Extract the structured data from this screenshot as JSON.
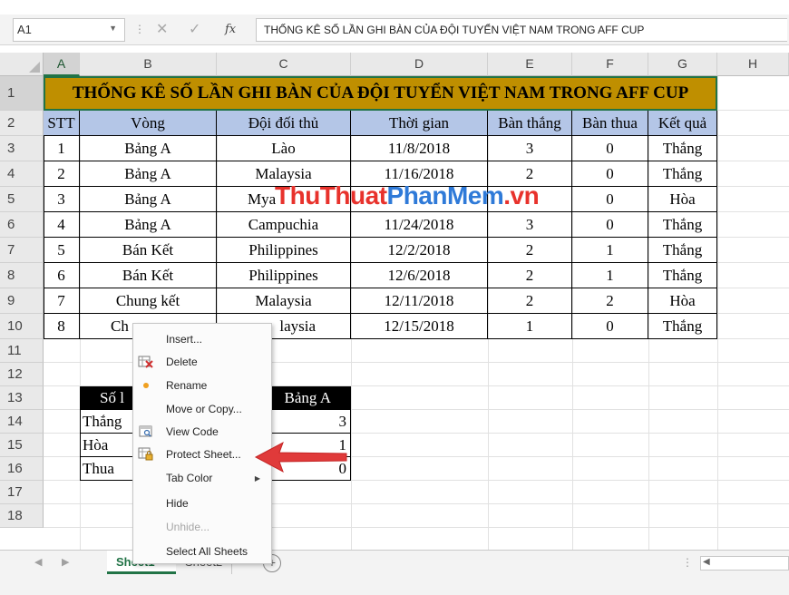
{
  "formula_bar": {
    "name_box": "A1",
    "fx_label": "fx",
    "formula": "THỐNG KÊ SỐ LẦN GHI BÀN CỦA ĐỘI TUYỂN VIỆT NAM TRONG AFF CUP"
  },
  "columns": [
    "A",
    "B",
    "C",
    "D",
    "E",
    "F",
    "G",
    "H"
  ],
  "rows": [
    "1",
    "2",
    "3",
    "4",
    "5",
    "6",
    "7",
    "8",
    "9",
    "10",
    "11",
    "12",
    "13",
    "14",
    "15",
    "16",
    "17",
    "18"
  ],
  "title": "THỐNG KÊ SỐ LẦN GHI BÀN CỦA ĐỘI TUYỂN VIỆT NAM TRONG AFF CUP",
  "table": {
    "headers": [
      "STT",
      "Vòng",
      "Đội đối thủ",
      "Thời gian",
      "Bàn thắng",
      "Bàn thua",
      "Kết quả"
    ],
    "rows": [
      [
        "1",
        "Bảng A",
        "Lào",
        "11/8/2018",
        "3",
        "0",
        "Thắng"
      ],
      [
        "2",
        "Bảng A",
        "Malaysia",
        "11/16/2018",
        "2",
        "0",
        "Thắng"
      ],
      [
        "3",
        "Bảng A",
        "Mya",
        "",
        "",
        "0",
        "Hòa"
      ],
      [
        "4",
        "Bảng A",
        "Campuchia",
        "11/24/2018",
        "3",
        "0",
        "Thắng"
      ],
      [
        "5",
        "Bán Kết",
        "Philippines",
        "12/2/2018",
        "2",
        "1",
        "Thắng"
      ],
      [
        "6",
        "Bán Kết",
        "Philippines",
        "12/6/2018",
        "2",
        "1",
        "Thắng"
      ],
      [
        "7",
        "Chung kết",
        "Malaysia",
        "12/11/2018",
        "2",
        "2",
        "Hòa"
      ],
      [
        "8",
        "Ch",
        "laysia",
        "12/15/2018",
        "1",
        "0",
        "Thắng"
      ]
    ]
  },
  "summary": {
    "header_left": "Số l",
    "header_right": "Bảng A",
    "rows": [
      {
        "label": "Thắng",
        "value": "3"
      },
      {
        "label": "Hòa",
        "value": "1"
      },
      {
        "label": "Thua",
        "value": "0"
      }
    ]
  },
  "watermark": {
    "part1": "ThuThuat",
    "part2": "PhanMem",
    "part3": ".vn"
  },
  "context_menu": [
    {
      "label": "Insert...",
      "icon": "",
      "disabled": false
    },
    {
      "label": "Delete",
      "icon": "delete-sheet-icon",
      "disabled": false
    },
    {
      "label": "Rename",
      "icon": "dot-icon",
      "disabled": false
    },
    {
      "label": "Move or Copy...",
      "icon": "",
      "disabled": false
    },
    {
      "label": "View Code",
      "icon": "view-code-icon",
      "disabled": false
    },
    {
      "label": "Protect Sheet...",
      "icon": "protect-sheet-icon",
      "disabled": false
    },
    {
      "label": "Tab Color",
      "icon": "",
      "disabled": false,
      "submenu": true
    },
    {
      "label": "Hide",
      "icon": "",
      "disabled": false
    },
    {
      "label": "Unhide...",
      "icon": "",
      "disabled": true
    },
    {
      "label": "Select All Sheets",
      "icon": "",
      "disabled": false
    }
  ],
  "tabs": {
    "active": "Sheet1",
    "other": "Sheet2",
    "add": "+"
  },
  "colors": {
    "title_fill": "#bf8f00",
    "header_fill": "#b4c6e7",
    "excel_green": "#217346",
    "arrow": "#e03a3a"
  }
}
